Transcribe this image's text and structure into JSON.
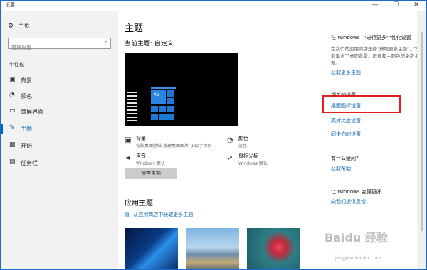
{
  "window": {
    "title": "设置",
    "min": "—",
    "max": "☐",
    "close": "✕"
  },
  "sidebar": {
    "home": "主页",
    "search_placeholder": "查找设置",
    "section": "个性化",
    "items": [
      {
        "label": "背景",
        "icon": "image-icon",
        "glyph": "▣"
      },
      {
        "label": "颜色",
        "icon": "palette-icon",
        "glyph": "◔"
      },
      {
        "label": "锁屏界面",
        "icon": "lock-screen-icon",
        "glyph": "▭"
      },
      {
        "label": "主题",
        "icon": "brush-icon",
        "glyph": "✎",
        "active": true
      },
      {
        "label": "开始",
        "icon": "start-icon",
        "glyph": "▦"
      },
      {
        "label": "任务栏",
        "icon": "taskbar-icon",
        "glyph": "▤"
      }
    ]
  },
  "main": {
    "title": "主题",
    "current_theme": "当前主题: 自定义",
    "preview_tile_text": "Aa",
    "props": [
      {
        "name": "背景",
        "value": "电脑桌面壁纸-搜建桌面图片-汉仪字体网"
      },
      {
        "name": "颜色",
        "value": "蓝色"
      },
      {
        "name": "声音",
        "value": "Windows 默认"
      },
      {
        "name": "鼠标光标",
        "value": "Windows 默认"
      }
    ],
    "save_button": "保存主题",
    "apply_theme": "应用主题",
    "store_link": "从应用商店中获取更多主题"
  },
  "right": {
    "more_title": "在 Windows 中进行更多个性化设置",
    "more_text": "在我们的应用商店选择\"获取更多主题\"，下载集合了桌面背景、声音和主题色的免费主题。",
    "more_link": "获取更多主题",
    "related_title": "相关的设置",
    "related_links": [
      "桌面图标设置",
      "高对比度设置",
      "同步你的设置"
    ],
    "question_title": "有什么疑问?",
    "help_link": "获取帮助",
    "better_title": "让 Windows 变得更好",
    "feedback_link": "向我们提供反馈"
  },
  "watermark": {
    "brand": "Baidu 经验",
    "url": "jingyan.baidu.com"
  }
}
